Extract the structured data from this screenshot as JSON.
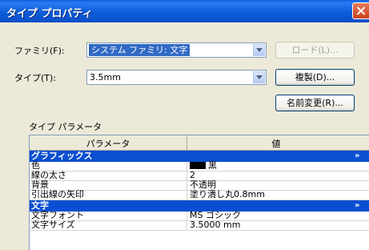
{
  "window": {
    "title": "タイプ プロパティ"
  },
  "family": {
    "label": "ファミリ(F):",
    "value": "システム ファミリ: 文字"
  },
  "type": {
    "label": "タイプ(T):",
    "value": "3.5mm"
  },
  "buttons": {
    "load": "ロード(L)...",
    "duplicate": "複製(D)...",
    "rename": "名前変更(R)..."
  },
  "section_label": "タイプ パラメータ",
  "grid": {
    "headers": [
      "パラメータ",
      "値"
    ],
    "groups": [
      {
        "name": "グラフィックス",
        "rows": [
          {
            "param": "色",
            "value": "黒"
          },
          {
            "param": "線の太さ",
            "value": "2"
          },
          {
            "param": "背景",
            "value": "不透明"
          },
          {
            "param": "引出線の矢印",
            "value": "塗り潰し丸0.8mm"
          }
        ]
      },
      {
        "name": "文字",
        "rows": [
          {
            "param": "文字フォント",
            "value": "MS ゴシック"
          },
          {
            "param": "文字サイズ",
            "value": "3.5000 mm"
          }
        ]
      }
    ],
    "collapse_glyph": "»",
    "color_swatch": "#000000"
  },
  "colors": {
    "titlebar": "#0A5FE0",
    "selection": "#316AC5",
    "group_header": "#0A4FD1"
  }
}
